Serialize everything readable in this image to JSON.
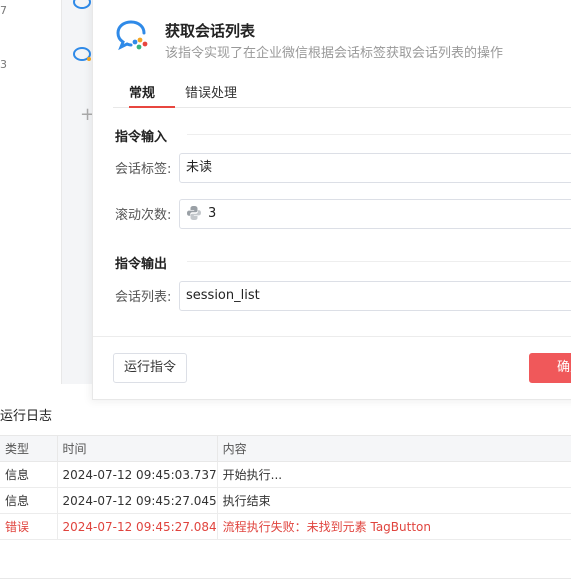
{
  "background": {
    "stub_text_1": "7",
    "stub_text_2": "3"
  },
  "dialog": {
    "title": "获取会话列表",
    "description": "该指令实现了在企业微信根据会话标签获取会话列表的操作",
    "tabs": [
      {
        "label": "常规",
        "active": true
      },
      {
        "label": "错误处理",
        "active": false
      }
    ],
    "input_section": "指令输入",
    "output_section": "指令输出",
    "fields": {
      "session_tag": {
        "label": "会话标签:",
        "value": "未读"
      },
      "scroll_count": {
        "label": "滚动次数:",
        "value": "3"
      },
      "session_list": {
        "label": "会话列表:",
        "value": "session_list"
      }
    },
    "run_button": "运行指令",
    "ok_button": "确定",
    "accent_color": "#e8463f",
    "ok_color": "#f0585a"
  },
  "log": {
    "title": "运行日志",
    "columns": [
      "类型",
      "时间",
      "内容"
    ],
    "rows": [
      {
        "type": "信息",
        "time": "2024-07-12 09:45:03.737",
        "content": "开始执行...",
        "error": false
      },
      {
        "type": "信息",
        "time": "2024-07-12 09:45:27.045",
        "content": "执行结束",
        "error": false
      },
      {
        "type": "错误",
        "time": "2024-07-12 09:45:27.084",
        "content": "流程执行失败：未找到元素 TagButton",
        "error": true
      }
    ]
  }
}
